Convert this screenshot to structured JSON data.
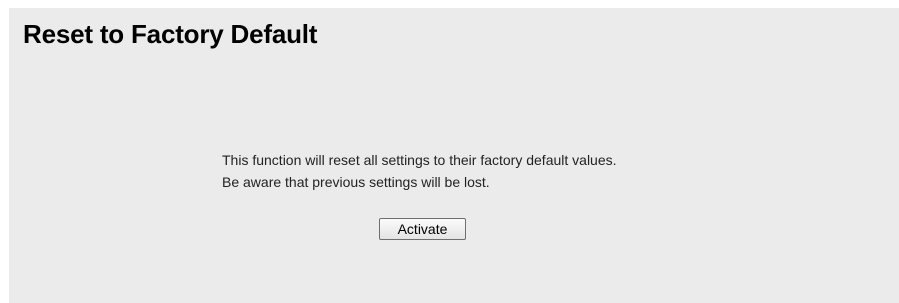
{
  "page": {
    "title": "Reset to Factory Default"
  },
  "message": {
    "line1": "This function will reset all settings to their factory default values.",
    "line2": "Be aware that previous settings will be lost."
  },
  "actions": {
    "activate_label": "Activate"
  },
  "colors": {
    "panel_background": "#ebebeb",
    "page_background": "#ffffff",
    "text": "#222222"
  }
}
